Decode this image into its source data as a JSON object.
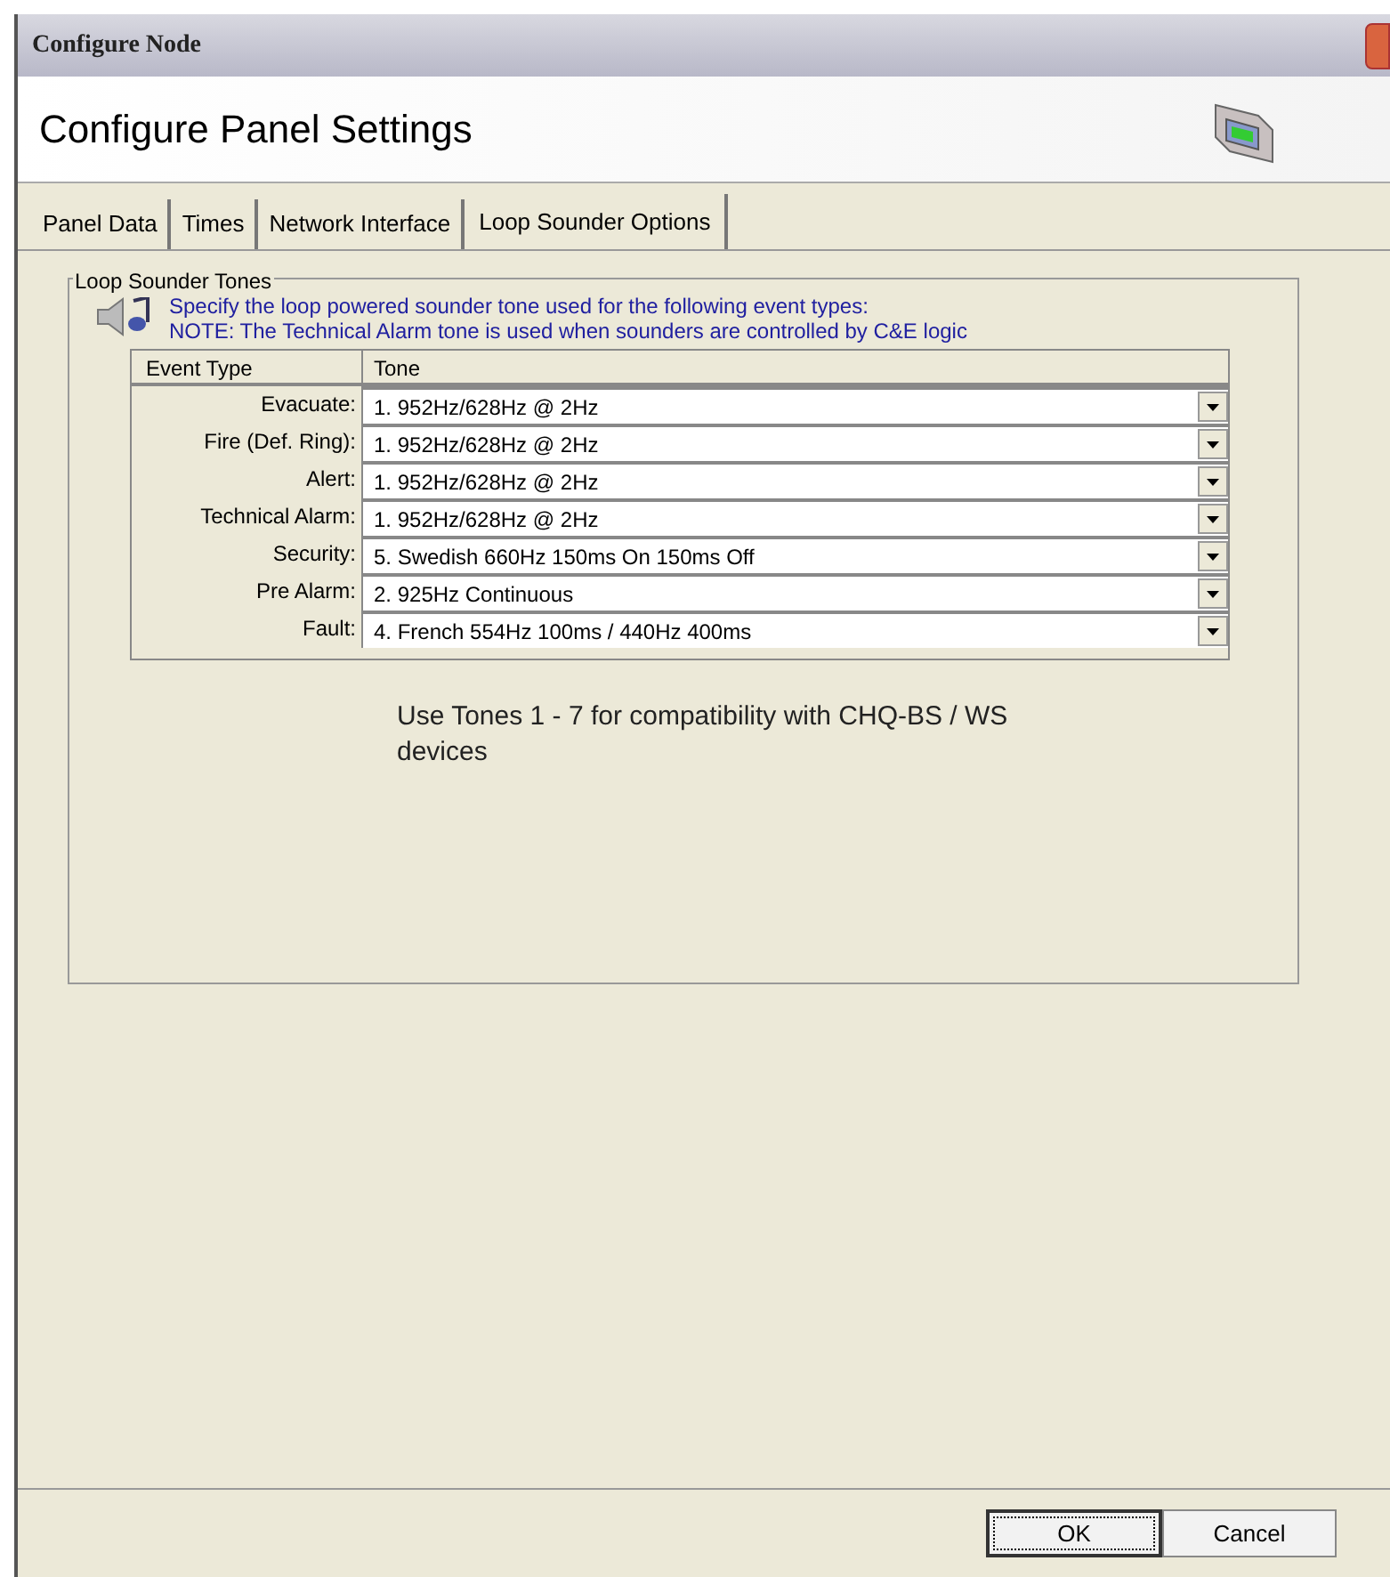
{
  "window": {
    "title": "Configure Node"
  },
  "header": {
    "title": "Configure Panel Settings"
  },
  "tabs": [
    {
      "label": "Panel Data",
      "selected": false
    },
    {
      "label": "Times",
      "selected": false
    },
    {
      "label": "Network Interface",
      "selected": false
    },
    {
      "label": "Loop Sounder Options",
      "selected": true
    }
  ],
  "group": {
    "title": "Loop Sounder Tones",
    "description": [
      "Specify the loop powered sounder tone used for the following event types:",
      "NOTE: The Technical Alarm tone is used when sounders are controlled by C&E logic"
    ]
  },
  "table": {
    "columns": [
      "Event Type",
      "Tone"
    ],
    "rows": [
      {
        "event": "Evacuate:",
        "tone": "1. 952Hz/628Hz @ 2Hz"
      },
      {
        "event": "Fire (Def. Ring):",
        "tone": "1. 952Hz/628Hz @ 2Hz"
      },
      {
        "event": "Alert:",
        "tone": "1. 952Hz/628Hz @ 2Hz"
      },
      {
        "event": "Technical Alarm:",
        "tone": "1. 952Hz/628Hz @ 2Hz"
      },
      {
        "event": "Security:",
        "tone": "5. Swedish 660Hz 150ms On 150ms Off"
      },
      {
        "event": "Pre Alarm:",
        "tone": "2. 925Hz Continuous"
      },
      {
        "event": "Fault:",
        "tone": "4. French 554Hz 100ms / 440Hz 400ms"
      }
    ]
  },
  "note": "Use Tones 1 - 7 for compatibility with CHQ-BS / WS devices",
  "buttons": [
    {
      "label": "OK",
      "focused": true
    },
    {
      "label": "Cancel",
      "focused": false
    }
  ]
}
